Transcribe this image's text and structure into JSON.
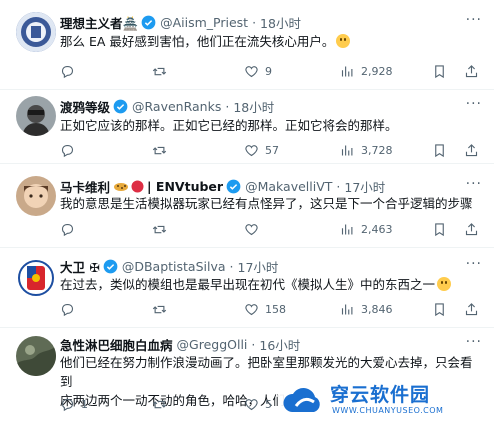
{
  "tweets": [
    {
      "name": "理想主义者🏯",
      "handle": "@Aiism_Priest",
      "time": "18小时",
      "text": "那么 EA 最好感到害怕，他们正在流失核心用户。",
      "emoji": "sweat-smile-emoji",
      "replies": "",
      "retweets": "",
      "likes": "9",
      "views": "2,928"
    },
    {
      "name": "渡鸦等级",
      "handle": "@RavenRanks",
      "time": "18小时",
      "text": "正如它应该的那样。正如它已经的那样。正如它将会的那样。",
      "replies": "",
      "retweets": "",
      "likes": "57",
      "views": "3,728"
    },
    {
      "name": "马卡维利",
      "name_suffix": "| ENVtuber",
      "handle": "@MakavelliVT",
      "time": "17小时",
      "text": "我的意思是生活模拟器玩家已经有点怪异了，这只是下一个合乎逻辑的步骤",
      "replies": "",
      "retweets": "",
      "likes": "",
      "views": "2,463"
    },
    {
      "name": "大卫 ✠",
      "handle": "@DBaptistaSilva",
      "time": "17小时",
      "text": "在过去，类似的模组也是最早出现在初代《模拟人生》中的东西之一",
      "emoji": "laughing-emoji",
      "replies": "",
      "retweets": "",
      "likes": "158",
      "views": "3,846"
    },
    {
      "name": "急性淋巴细胞白血病",
      "handle": "@GreggOlli",
      "time": "16小时",
      "text_line1": "他们已经在努力制作浪漫动画了。把卧室里那颗发光的大爱心去掉，只会看到",
      "text_line2": "床两边两个一动不动的角色，哈哈，人们会想",
      "replies": "1",
      "retweets": "",
      "likes": "5",
      "views": ""
    }
  ],
  "more_label": "···",
  "watermark": {
    "title": "穿云软件园",
    "url": "WWW.CHUANYUSEO.COM"
  },
  "colors": {
    "verified": "#1d9bf0",
    "muted": "#536471",
    "text": "#0f1419",
    "divider": "#eff3f4",
    "watermark": "#1a6fd0"
  }
}
